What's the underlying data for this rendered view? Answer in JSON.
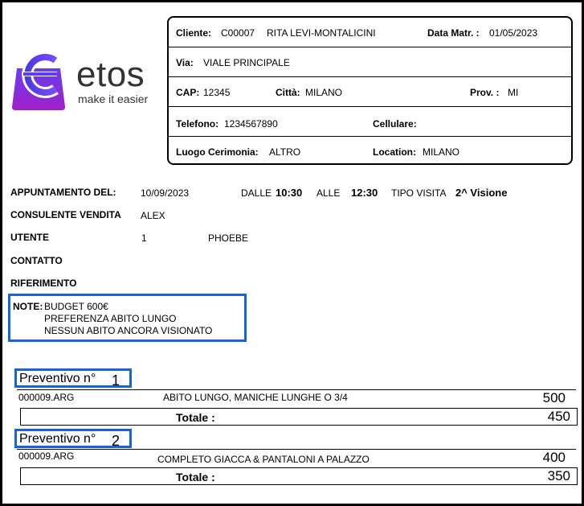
{
  "brand": {
    "name": "etos",
    "tagline": "make it easier"
  },
  "client": {
    "cliente_label": "Cliente:",
    "cliente_code": "C00007",
    "cliente_name": "RITA LEVI-MONTALICINI",
    "data_matr_label": "Data Matr. :",
    "data_matr": "01/05/2023",
    "via_label": "Via:",
    "via": "VIALE PRINCIPALE",
    "cap_label": "CAP:",
    "cap": "12345",
    "citta_label": "Città:",
    "citta": "MILANO",
    "prov_label": "Prov. :",
    "prov": "MI",
    "telefono_label": "Telefono:",
    "telefono": "1234567890",
    "cellulare_label": "Cellulare:",
    "cellulare": "",
    "luogo_label": "Luogo Cerimonia:",
    "luogo": "ALTRO",
    "location_label": "Location:",
    "location": "MILANO"
  },
  "appointment": {
    "appuntamento_label": "APPUNTAMENTO DEL:",
    "date": "10/09/2023",
    "dalle_label": "DALLE",
    "from_time": "10:30",
    "alle_label": "ALLE",
    "to_time": "12:30",
    "tipo_label": "TIPO VISITA",
    "tipo": "2^ Visione",
    "consulente_label": "CONSULENTE VENDITA",
    "consulente": "ALEX",
    "utente_label": "UTENTE",
    "utente_id": "1",
    "utente_name": "PHOEBE",
    "contatto_label": "CONTATTO",
    "riferimento_label": "RIFERIMENTO"
  },
  "notes": {
    "label": "NOTE:",
    "lines": [
      "BUDGET 600€",
      "PREFERENZA ABITO LUNGO",
      "NESSUN ABITO ANCORA VISIONATO"
    ]
  },
  "quotes": [
    {
      "label": "Preventivo n°",
      "number": "1",
      "item_code": "000009.ARG",
      "item_desc": "ABITO LUNGO, MANICHE LUNGHE O 3/4",
      "item_amount": "500",
      "total_label": "Totale :",
      "total": "450"
    },
    {
      "label": "Preventivo n°",
      "number": "2",
      "item_code": "000009.ARG",
      "item_desc": "COMPLETO GIACCA & PANTALONI A PALAZZO",
      "item_amount": "400",
      "total_label": "Totale :",
      "total": "350"
    }
  ],
  "colors": {
    "highlight_border": "#1565d6",
    "logo_purple": "#8e2de2",
    "logo_blue": "#3b5bdb"
  }
}
